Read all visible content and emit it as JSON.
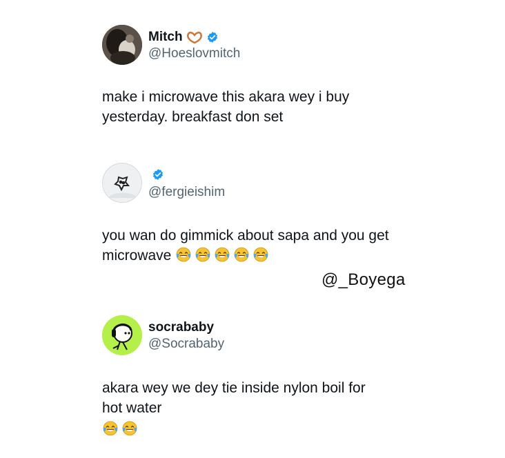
{
  "tweets": [
    {
      "name": "Mitch",
      "handle": "@Hoeslovmitch",
      "text_line1": "make i microwave this akara wey i buy",
      "text_line2": "yesterday. breakfast don set",
      "verified": true,
      "name_emoji": "heart-hands-emoji"
    },
    {
      "name": "",
      "handle": "@fergieishim",
      "text_line1": "you wan do gimmick about sapa and you get",
      "text_line2": "microwave",
      "verified": true,
      "laugh_emoji_count": 5
    },
    {
      "name": "socrababy",
      "handle": "@Socrababy",
      "text_line1": "akara wey we dey tie inside nylon boil for",
      "text_line2": "hot water",
      "verified": false,
      "laugh_emoji_count": 2
    }
  ],
  "watermark": "@_Boyega",
  "colors": {
    "verified_blue": "#1d9bf0",
    "handle_gray": "#536471",
    "socrababy_avatar_bg": "#b5f04a"
  }
}
